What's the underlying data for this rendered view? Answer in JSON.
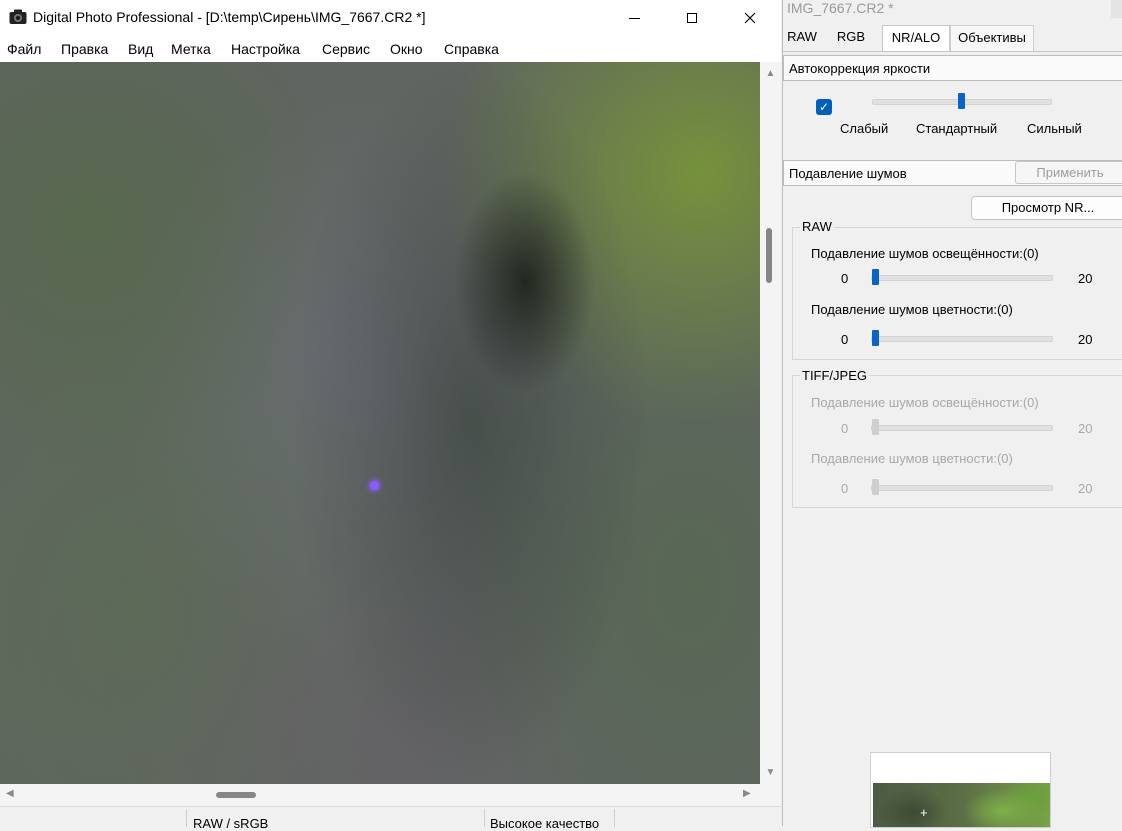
{
  "window": {
    "title": "Digital Photo Professional - [D:\\temp\\Сирень\\IMG_7667.CR2 *]",
    "minimize_glyph": "—",
    "maximize_glyph": "☐",
    "close_glyph": "✕"
  },
  "menu": [
    "Файл",
    "Правка",
    "Вид",
    "Метка",
    "Настройка",
    "Сервис",
    "Окно",
    "Справка"
  ],
  "scroll": {
    "up": "▲",
    "down": "▼",
    "left": "◀",
    "right": "▶"
  },
  "status": {
    "color_space": "RAW / sRGB",
    "quality": "Высокое качество"
  },
  "palette": {
    "title": "IMG_7667.CR2 *",
    "tabs": [
      "RAW",
      "RGB",
      "NR/ALO",
      "Объективы"
    ],
    "active_tab": "NR/ALO",
    "alo": {
      "header": "Автокоррекция яркости",
      "enabled": true,
      "check_glyph": "✓",
      "levels": [
        "Слабый",
        "Стандартный",
        "Сильный"
      ],
      "selected_level": "Стандартный"
    },
    "nr": {
      "header": "Подавление шумов",
      "apply_label": "Применить",
      "preview_label": "Просмотр NR...",
      "raw": {
        "group_label": "RAW",
        "luminance_label": "Подавление шумов освещённости:(0)",
        "luminance_value": 0,
        "chroma_label": "Подавление шумов цветности:(0)",
        "chroma_value": 0,
        "min_label": "0",
        "max_label": "20"
      },
      "tiff": {
        "group_label": "TIFF/JPEG",
        "luminance_label": "Подавление шумов освещённости:(0)",
        "chroma_label": "Подавление шумов цветности:(0)",
        "min_label": "0",
        "max_label": "20"
      }
    },
    "navigator_cross": "+"
  },
  "colors": {
    "accent": "#005fb8",
    "slider_thumb": "#0a64c8"
  }
}
